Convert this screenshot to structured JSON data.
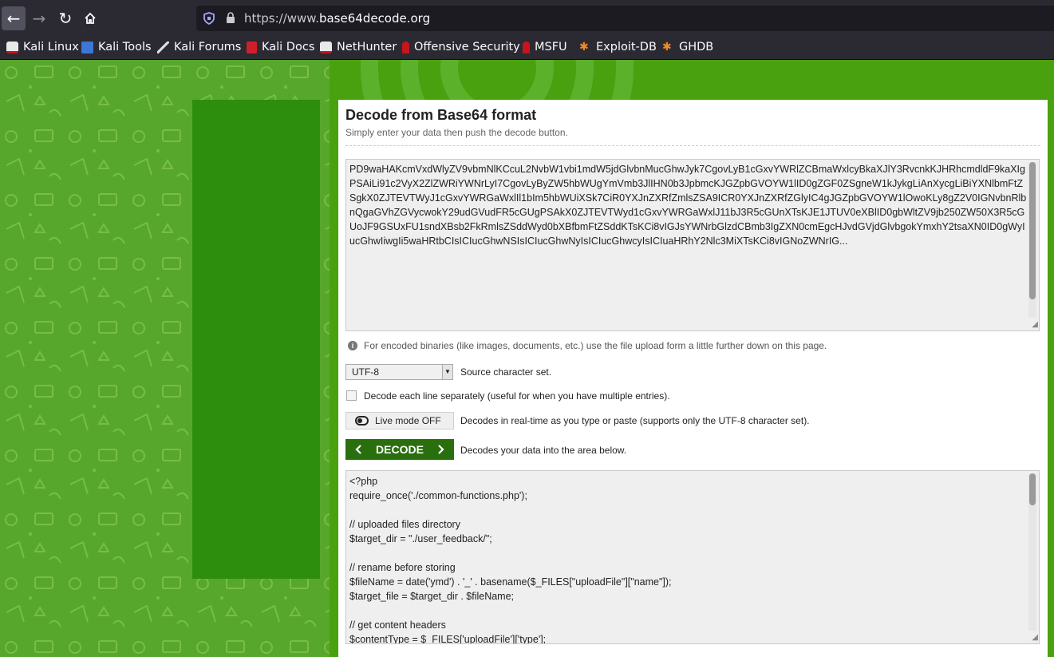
{
  "browser": {
    "url_prefix": "https://www.",
    "url_host": "base64decode.org",
    "back_icon": "arrow-left-icon",
    "forward_icon": "arrow-right-icon",
    "reload_icon": "reload-icon",
    "home_icon": "home-icon",
    "bookmarks": [
      "Kali Linux",
      "Kali Tools",
      "Kali Forums",
      "Kali Docs",
      "NetHunter",
      "Offensive Security",
      "MSFU",
      "Exploit-DB",
      "GHDB"
    ]
  },
  "colors": {
    "page_green": "#4aa10f",
    "decode_button": "#2a6f0e"
  },
  "decoder": {
    "title": "Decode from Base64 format",
    "subtitle": "Simply enter your data then push the decode button.",
    "input_text": "PD9waHAKcmVxdWlyZV9vbmNlKCcuL2NvbW1vbi1mdW5jdGlvbnMucGhwJyk7CgovLyB1cGxvYWRlZCBmaWxlcyBkaXJlY3RvcnkKJHRhcmdldF9kaXIgPSAiLi91c2VyX2ZlZWRiYWNrLyI7CgovLyByZW5hbWUgYmVmb3JlIHN0b3JpbmcKJGZpbGVOYW1lID0gZGF0ZSgneW1kJykgLiAnXycgLiBiYXNlbmFtZSgkX0ZJTEVTWyJ1cGxvYWRGaWxlIl1bIm5hbWUiXSk7CiR0YXJnZXRfZmlsZSA9ICR0YXJnZXRfZGlyIC4gJGZpbGVOYW1lOwoKLy8gZ2V0IGNvbnRlbnQgaGVhZGVycwokY29udGVudFR5cGUgPSAkX0ZJTEVTWyd1cGxvYWRGaWxlJ11bJ3R5cGUnXTsKJE1JTUV0eXBlID0gbWltZV9jb250ZW50X3R5cGUoJF9GSUxFU1sndXBsb2FkRmlsZSddWyd0bXBfbmFtZSddKTsKCi8vIGJsYWNrbGlzdCBmb3IgZXN0cmEgcHJvdGVjdGlvbgokYmxhY2tsaXN0ID0gWyIucGhwIiwgIi5waHRtbCIsICIucGhwNSIsICIucGhwNyIsICIucGhwcyIsICIuaHRhY2Nlc3MiXTsKCi8vIGNoZWNrIG...",
    "info_text": "For encoded binaries (like images, documents, etc.) use the file upload form a little further down on this page.",
    "charset_value": "UTF-8",
    "charset_desc": "Source character set.",
    "lines_label": "Decode each line separately (useful for when you have multiple entries).",
    "live_label": "Live mode OFF",
    "live_desc": "Decodes in real-time as you type or paste (supports only the UTF-8 character set).",
    "decode_label": "DECODE",
    "decode_desc": "Decodes your data into the area below.",
    "output_text": "<?php\nrequire_once('./common-functions.php');\n\n// uploaded files directory\n$target_dir = \"./user_feedback/\";\n\n// rename before storing\n$fileName = date('ymd') . '_' . basename($_FILES[\"uploadFile\"][\"name\"]);\n$target_file = $target_dir . $fileName;\n\n// get content headers\n$contentType = $_FILES['uploadFile']['type'];"
  }
}
